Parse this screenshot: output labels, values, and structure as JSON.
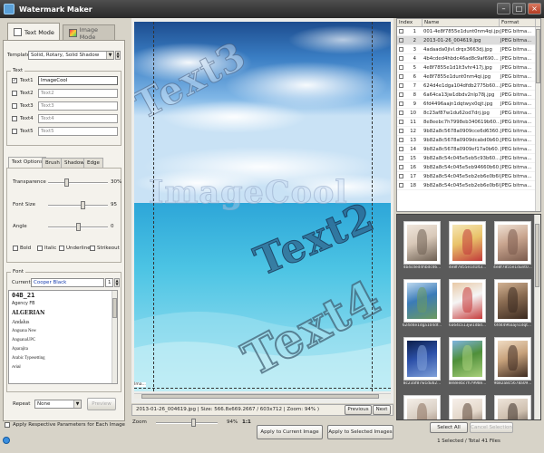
{
  "window": {
    "title": "Watermark Maker"
  },
  "mode_tabs": [
    {
      "label": "Text Mode",
      "active": true
    },
    {
      "label": "Image Mode",
      "active": false
    }
  ],
  "template": {
    "label": "Template",
    "value": "Solid, Rotary, Solid Shadow"
  },
  "text_group": {
    "label": "Text",
    "items": [
      {
        "label": "Text1",
        "value": "ImageCool",
        "checked": true
      },
      {
        "label": "Text2",
        "value": "Text2",
        "checked": false
      },
      {
        "label": "Text3",
        "value": "Text3",
        "checked": false
      },
      {
        "label": "Text4",
        "value": "Text4",
        "checked": false
      },
      {
        "label": "Text5",
        "value": "Text5",
        "checked": false
      }
    ]
  },
  "options_tabs": [
    "Text Options",
    "Brush",
    "Shadow",
    "Edge"
  ],
  "options": {
    "transparence": {
      "label": "Transparence",
      "value": "30%",
      "level": 0.3
    },
    "font_size": {
      "label": "Font Size",
      "value": "95",
      "level": 0.58
    },
    "angle": {
      "label": "Angle",
      "value": "0",
      "level": 0.5
    },
    "styles": [
      "Bold",
      "Italic",
      "Underline",
      "Strikeout"
    ]
  },
  "font": {
    "group_label": "Font",
    "current_label": "Current",
    "current_value": "Cooper Black",
    "size_value": "1",
    "list": [
      "04B_21",
      "Agency FB",
      "ALGERIAN",
      "Andalus",
      "Angsana New",
      "AngsanaUPC",
      "Aparajita",
      "Arabic Typesetting",
      "Arial"
    ]
  },
  "repeat": {
    "label": "Repeat",
    "value": "None",
    "preview_label": "Preview"
  },
  "apply_respective": {
    "label": "Apply Respective Parameters for Each Image"
  },
  "preview": {
    "watermarks": [
      "Text3",
      "ImageCool",
      "Text2",
      "Text4"
    ],
    "corner_label": "Ima...",
    "status": "2013-01-26_004619.jpg  |  Size: 566.8x669.2667 / 603x712  |  Zoom: 94% )",
    "prev_label": "Previous",
    "next_label": "Next"
  },
  "zoom": {
    "label": "Zoom",
    "value": "94%",
    "ratio": "1:1",
    "level": 0.6
  },
  "actions": {
    "apply_current": "Apply to Current Image",
    "apply_selected": "Apply to Selected Images"
  },
  "file_table": {
    "columns": [
      "Index",
      "Name",
      "Format"
    ],
    "rows": [
      {
        "index": "1",
        "name": "001-4e8f7855e1dunt0nm4qi.jpg",
        "format": "JPEG bitma..."
      },
      {
        "index": "2",
        "name": "2013-01-26_004619.jpg",
        "format": "JPEG bitma...",
        "selected": true
      },
      {
        "index": "3",
        "name": "4adaada0jivl.drqx3663dj.jpg",
        "format": "JPEG bitma..."
      },
      {
        "index": "4",
        "name": "4b4cded4hbdc46ad8c9af690...",
        "format": "JPEG bitma..."
      },
      {
        "index": "5",
        "name": "4e8f7855e1d1lt3vhr417j.jpg",
        "format": "JPEG bitma..."
      },
      {
        "index": "6",
        "name": "4e8f7855e1dunt0nm4qi.jpg",
        "format": "JPEG bitma..."
      },
      {
        "index": "7",
        "name": "624d4e1dga104dfdb2775b60...",
        "format": "JPEG bitma..."
      },
      {
        "index": "8",
        "name": "6a64ca13jw1dbdv2nlp78j.jpg",
        "format": "JPEG bitma..."
      },
      {
        "index": "9",
        "name": "6fd4496aajn1dqtwyx0qjt.jpg",
        "format": "JPEG bitma..."
      },
      {
        "index": "10",
        "name": "8c23af87w1du62od7drj.jpg",
        "format": "JPEG bitma..."
      },
      {
        "index": "11",
        "name": "8e8eebc7h7998eb340619b60...",
        "format": "JPEG bitma..."
      },
      {
        "index": "12",
        "name": "9b82a8c5678a0909cce6d6360...",
        "format": "JPEG bitma..."
      },
      {
        "index": "13",
        "name": "9b82a8c5678a0909dcabd0b60...",
        "format": "JPEG bitma..."
      },
      {
        "index": "14",
        "name": "9b82a8c5678a0909ef17a0b60...",
        "format": "JPEG bitma..."
      },
      {
        "index": "15",
        "name": "9b82a8c54c045e5eb5c93b60...",
        "format": "JPEG bitma..."
      },
      {
        "index": "16",
        "name": "9b82a8c54c045e5eb94660b60...",
        "format": "JPEG bitma..."
      },
      {
        "index": "17",
        "name": "9b82a8c54c045e5eb2eb6e0b60...",
        "format": "JPEG bitma..."
      },
      {
        "index": "18",
        "name": "9b82a8c54c045e5eb2eb6e0b60...",
        "format": "JPEG bitma..."
      }
    ]
  },
  "thumbnails": [
    {
      "caption": "4b4cded4hbdc46...",
      "colors": [
        "#d8c8b8",
        "#6d5f52",
        "#f0e6dc"
      ]
    },
    {
      "caption": "4e8f7855e1d1lt3...",
      "colors": [
        "#e9c36a",
        "#c23a3a",
        "#f6e7b7"
      ]
    },
    {
      "caption": "4e8f7855e1dunt0...",
      "colors": [
        "#c9a58f",
        "#7a5a4c",
        "#efe1d4"
      ]
    },
    {
      "caption": "624d4e1dga104df...",
      "colors": [
        "#3b7bb8",
        "#6c9a5f",
        "#bcd8ef"
      ]
    },
    {
      "caption": "6a64ca13jw1dbd...",
      "colors": [
        "#f5f5f5",
        "#c63b3b",
        "#e8c9a6"
      ]
    },
    {
      "caption": "6fd4496aajn1dqt...",
      "colors": [
        "#8a6c52",
        "#3b2a20",
        "#d3b394"
      ]
    },
    {
      "caption": "8c23af87w1du62...",
      "colors": [
        "#2c50a8",
        "#7fa0d8",
        "#0c1f4a"
      ]
    },
    {
      "caption": "8e8eebc7h7998e...",
      "colors": [
        "#4f8f3a",
        "#a8cf7a",
        "#7eb4e0"
      ]
    },
    {
      "caption": "9b82a8c5678a09...",
      "colors": [
        "#c7a27c",
        "#3f2c22",
        "#f0dcc4"
      ]
    },
    {
      "caption": "",
      "colors": [
        "#d9cfc4",
        "#8b6f5c",
        "#f5efe8"
      ]
    },
    {
      "caption": "",
      "colors": [
        "#e4d8cb",
        "#5b4536",
        "#f7f0ea"
      ]
    },
    {
      "caption": "",
      "colors": [
        "#cfc0b0",
        "#3d2f28",
        "#efe5da"
      ]
    }
  ],
  "selection": {
    "select_all": "Select All",
    "cancel": "Cancel Selection",
    "summary": "1 Selected / Total 41 Files"
  }
}
